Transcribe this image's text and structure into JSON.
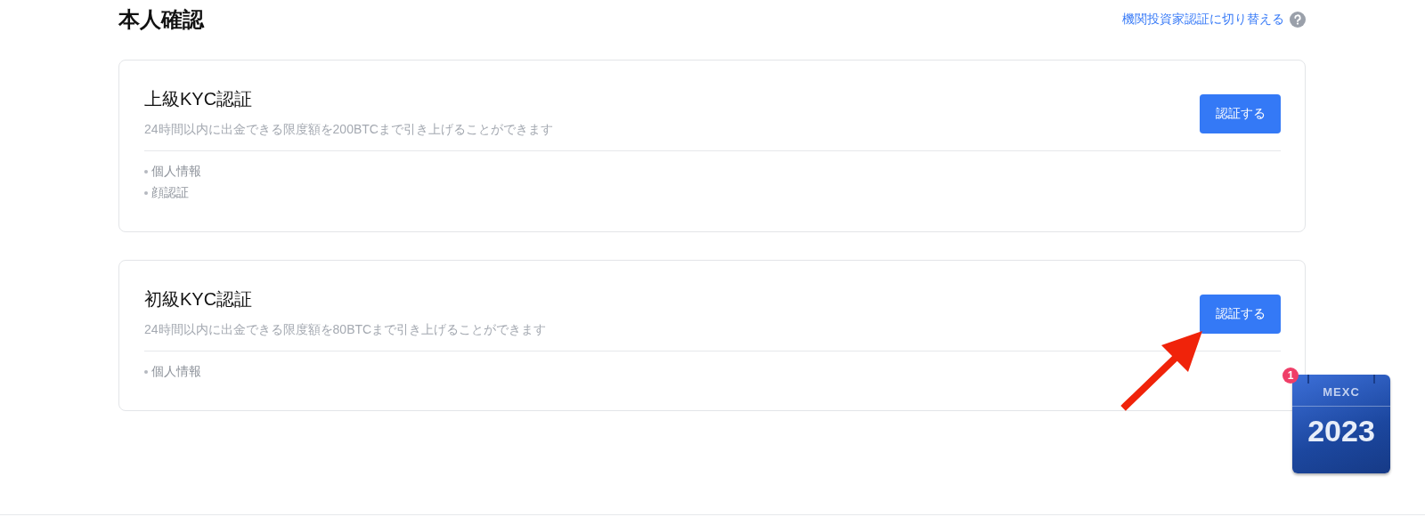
{
  "page_title": "本人確認",
  "switch_link": {
    "label": "機関投資家認証に切り替える"
  },
  "cards": [
    {
      "title": "上級KYC認証",
      "description": "24時間以内に出金できる限度額を200BTCまで引き上げることができます",
      "button": "認証する",
      "requirements": [
        "個人情報",
        "顔認証"
      ]
    },
    {
      "title": "初級KYC認証",
      "description": "24時間以内に出金できる限度額を80BTCまで引き上げることができます",
      "button": "認証する",
      "requirements": [
        "個人情報"
      ]
    }
  ],
  "calendar_widget": {
    "brand": "MEXC",
    "year": "2023",
    "badge": "1"
  }
}
